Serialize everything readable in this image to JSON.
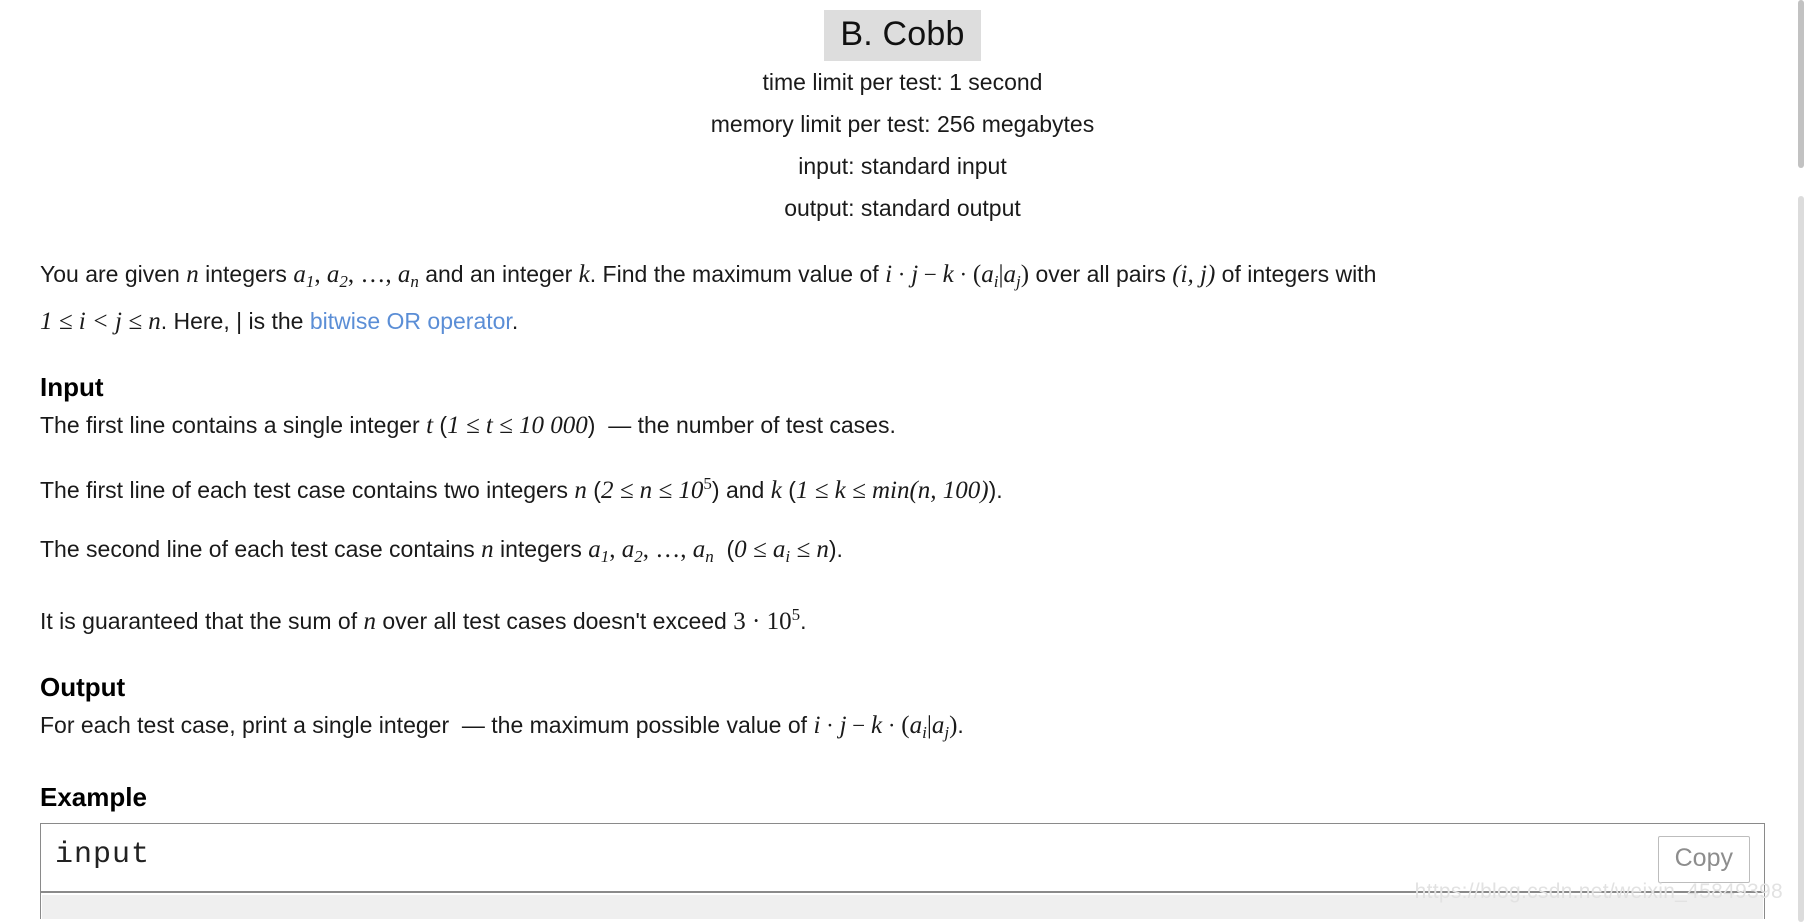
{
  "header": {
    "title": "B. Cobb",
    "meta": [
      "time limit per test: 1 second",
      "memory limit per test: 256 megabytes",
      "input: standard input",
      "output: standard output"
    ]
  },
  "legend": {
    "line1_a": "You are given ",
    "n1": "n",
    "line1_b": " integers ",
    "a1": "a",
    "a1sub": "1",
    "comma1": ", ",
    "a2": "a",
    "a2sub": "2",
    "comma2": ", ",
    "dots": "…",
    "comma3": ", ",
    "an": "a",
    "ansub": "n",
    "line1_c": " and an integer ",
    "k1": "k",
    "line1_d": ". Find the maximum value of ",
    "formula_i": "i",
    "dot1": " · ",
    "formula_j": "j",
    "minus": " − ",
    "formula_k": "k",
    "dot2": " · ",
    "paren_open": "(",
    "ai": "a",
    "aisub": "i",
    "bar": "|",
    "aj": "a",
    "ajsub": "j",
    "paren_close": ")",
    "line1_e": " over all pairs ",
    "pair": "(i, j)",
    "line1_f": " of integers with",
    "line2_ineq": "1 ≤ i < j ≤ n",
    "line2_a": ". Here, | is the ",
    "link_text": "bitwise OR operator",
    "line2_b": "."
  },
  "input_section": {
    "heading": "Input",
    "p1_a": "The first line contains a single integer ",
    "p1_t": "t",
    "p1_b": " (",
    "p1_range": "1 ≤ t ≤ 10 000",
    "p1_c": ")",
    "p1_d": "— the number of test cases.",
    "p2_a": "The first line of each test case contains two integers ",
    "p2_n": "n",
    "p2_b": " (",
    "p2_nrange_pre": "2 ≤ n ≤ 10",
    "p2_nexp": "5",
    "p2_c": ") and ",
    "p2_k": "k",
    "p2_d": " (",
    "p2_krange": "1 ≤ k ≤ min(n, 100)",
    "p2_e": ").",
    "p3_a": "The second line of each test case contains ",
    "p3_n": "n",
    "p3_b": " integers ",
    "p3_a1": "a",
    "p3_a1sub": "1",
    "p3_comma1": ", ",
    "p3_a2": "a",
    "p3_a2sub": "2",
    "p3_comma2": ", ",
    "p3_dots": "…",
    "p3_comma3": ", ",
    "p3_an": "a",
    "p3_ansub": "n",
    "p3_c": " (",
    "p3_range_pre": "0 ≤ a",
    "p3_range_sub": "i",
    "p3_range_post": " ≤ n",
    "p3_d": ").",
    "p4_a": "It is guaranteed that the sum of ",
    "p4_n": "n",
    "p4_b": " over all test cases doesn't exceed ",
    "p4_val_pre": "3 · 10",
    "p4_val_exp": "5",
    "p4_c": "."
  },
  "output_section": {
    "heading": "Output",
    "p1_a": "For each test case, print a single integer ",
    "p1_dash": "— the maximum possible value of ",
    "f_i": "i",
    "f_dot1": " · ",
    "f_j": "j",
    "f_minus": " − ",
    "f_k": "k",
    "f_dot2": " · ",
    "f_open": "(",
    "f_ai": "a",
    "f_aisub": "i",
    "f_bar": "|",
    "f_aj": "a",
    "f_ajsub": "j",
    "f_close": ")",
    "p1_end": "."
  },
  "example_section": {
    "heading": "Example",
    "input_label": "input",
    "copy_label": "Copy"
  },
  "watermark": "https://blog.csdn.net/weixin_45849398",
  "colors": {
    "link": "#5b8ed6",
    "title_highlight": "#dddddd",
    "copy_border": "#bdbdbd",
    "text": "#1a1a1a"
  }
}
